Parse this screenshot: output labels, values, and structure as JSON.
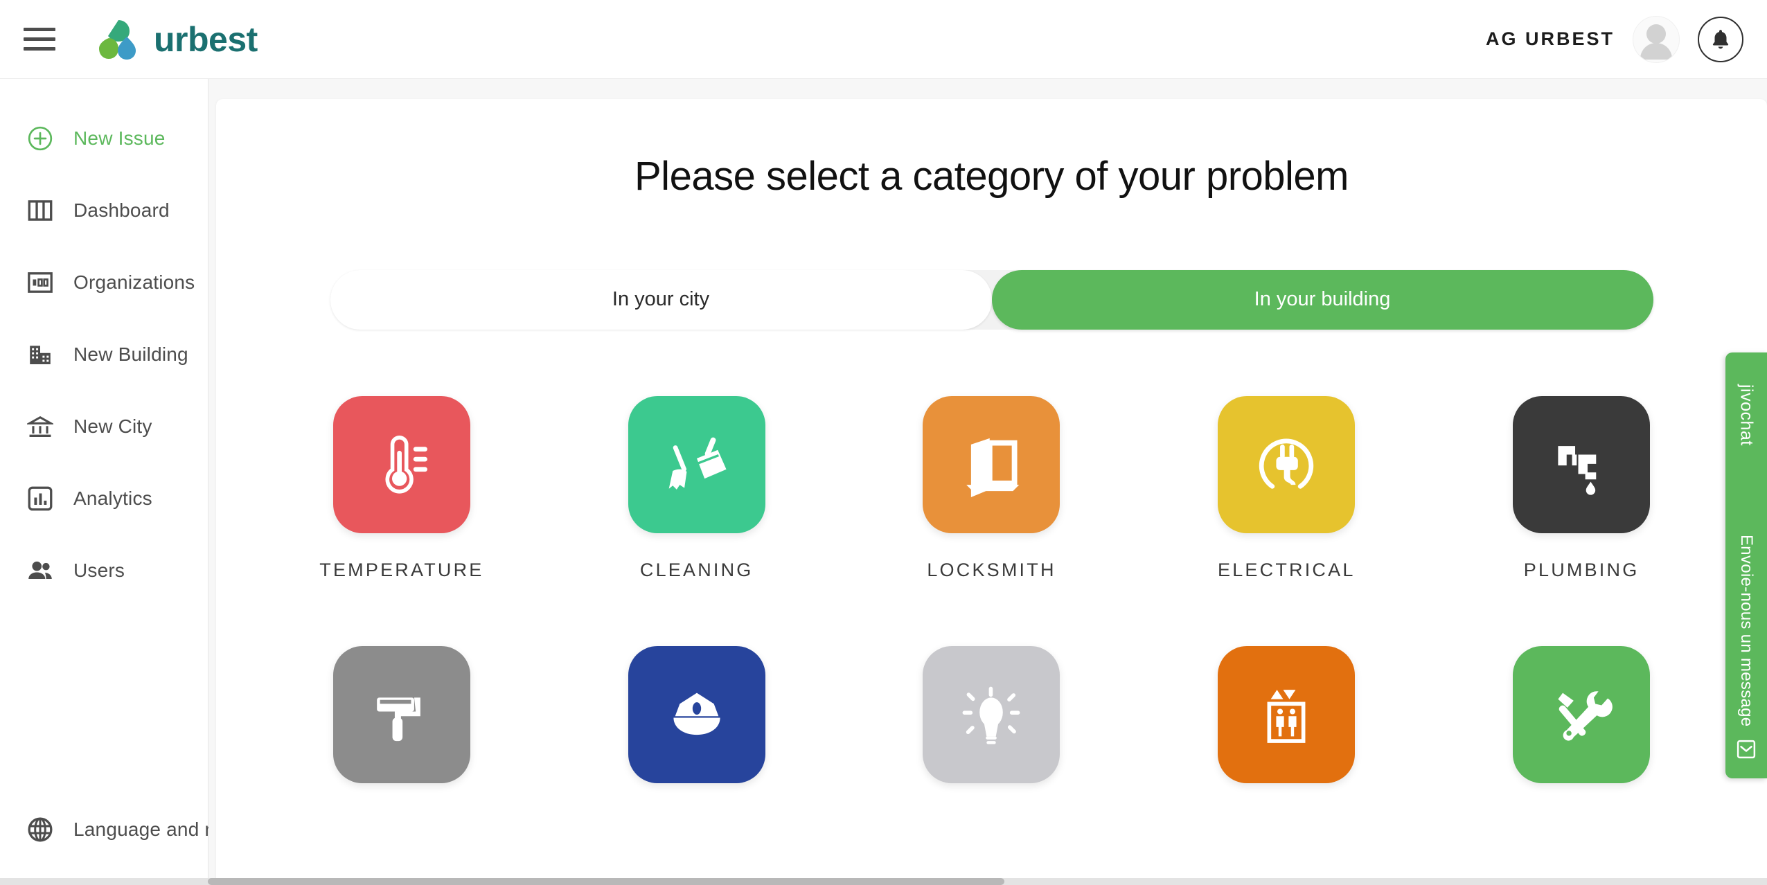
{
  "header": {
    "menu_icon": "hamburger-menu-icon",
    "logo_text": "urbest",
    "account_name": "AG URBEST",
    "avatar_icon": "user-avatar-icon",
    "notifications_icon": "bell-icon",
    "brand_color": "#1b7070",
    "logo_colors": [
      "#35a97b",
      "#6cb83f",
      "#3d9bc7"
    ]
  },
  "sidebar": {
    "items": [
      {
        "label": "New Issue",
        "icon": "plus-circle-icon",
        "active": true
      },
      {
        "label": "Dashboard",
        "icon": "columns-icon",
        "active": false
      },
      {
        "label": "Organizations",
        "icon": "organization-icon",
        "active": false
      },
      {
        "label": "New Building",
        "icon": "building-icon",
        "active": false
      },
      {
        "label": "New City",
        "icon": "bank-icon",
        "active": false
      },
      {
        "label": "Analytics",
        "icon": "bar-chart-icon",
        "active": false
      },
      {
        "label": "Users",
        "icon": "people-icon",
        "active": false
      }
    ],
    "bottom": {
      "label": "Language and more",
      "icon": "globe-icon"
    },
    "active_color": "#5cb85c",
    "text_color": "#4d4d4d"
  },
  "main": {
    "title": "Please select a category of your problem",
    "scope_toggle": {
      "options": [
        {
          "label": "In your city",
          "selected": false
        },
        {
          "label": "In your building",
          "selected": true
        }
      ],
      "selected_color": "#5cb85c"
    },
    "categories": [
      {
        "label": "TEMPERATURE",
        "icon": "thermometer-icon",
        "color": "#e8575c"
      },
      {
        "label": "CLEANING",
        "icon": "broom-icon",
        "color": "#3cc98f"
      },
      {
        "label": "LOCKSMITH",
        "icon": "open-door-icon",
        "color": "#e8913a"
      },
      {
        "label": "ELECTRICAL",
        "icon": "power-plug-icon",
        "color": "#e6c32e"
      },
      {
        "label": "PLUMBING",
        "icon": "faucet-icon",
        "color": "#3a3a3a"
      },
      {
        "label": "",
        "icon": "paint-roller-icon",
        "color": "#8c8c8c"
      },
      {
        "label": "",
        "icon": "police-cap-icon",
        "color": "#27449c"
      },
      {
        "label": "",
        "icon": "lightbulb-icon",
        "color": "#c8c8cc"
      },
      {
        "label": "",
        "icon": "elevator-icon",
        "color": "#e2700f"
      },
      {
        "label": "",
        "icon": "hammer-wrench-icon",
        "color": "#5cb85c"
      }
    ]
  },
  "chat_widget": {
    "brand": "jivochat",
    "message": "Envoie-nous un message",
    "icon": "chat-envelope-icon",
    "color": "#5cb85c"
  }
}
